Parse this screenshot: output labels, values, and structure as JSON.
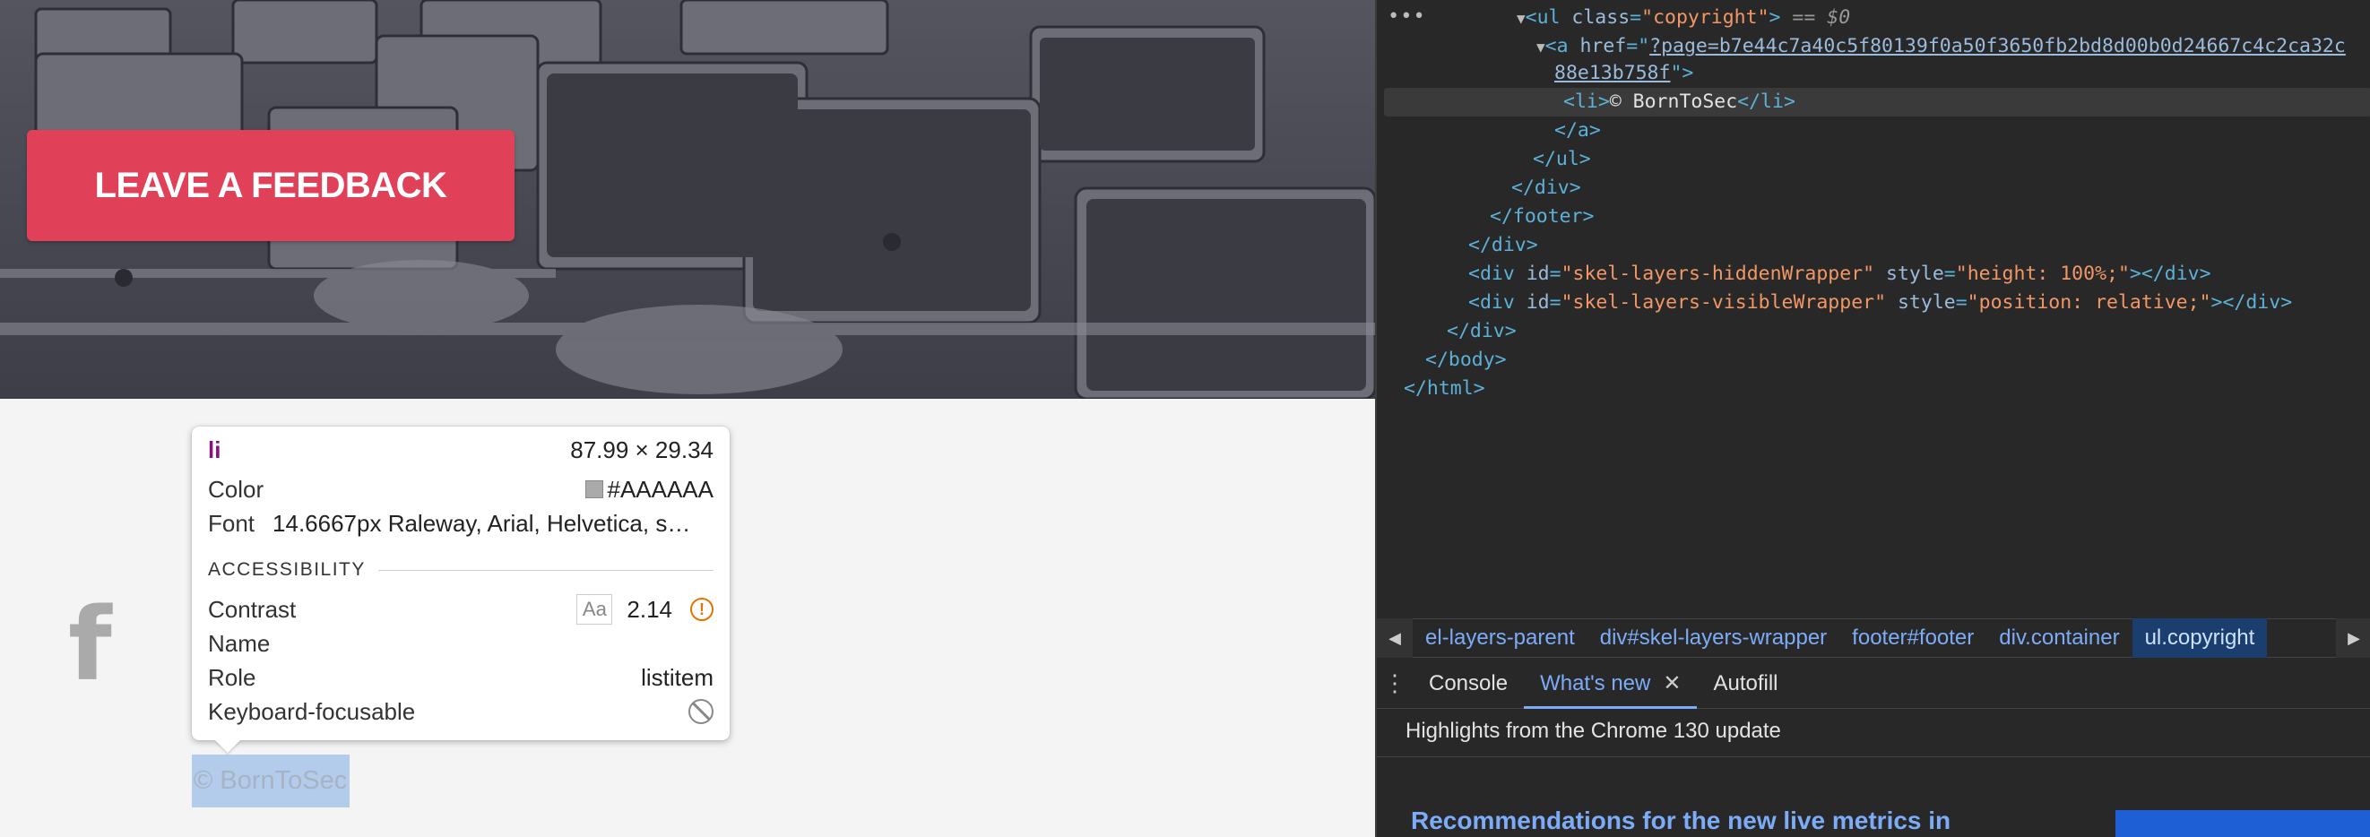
{
  "site": {
    "feedback_button": "LEAVE A FEEDBACK",
    "facebook_glyph": "f",
    "copyright": "© BornToSec"
  },
  "tooltip": {
    "tag": "li",
    "dimensions": "87.99 × 29.34",
    "color_label": "Color",
    "color_value": "#AAAAAA",
    "font_label": "Font",
    "font_value": "14.6667px Raleway, Arial, Helvetica, s…",
    "section_title": "ACCESSIBILITY",
    "contrast_label": "Contrast",
    "contrast_aa": "Aa",
    "contrast_value": "2.14",
    "name_label": "Name",
    "role_label": "Role",
    "role_value": "listitem",
    "keyboard_label": "Keyboard-focusable",
    "icons": [
      "warning-icon",
      "not-focusable-icon"
    ]
  },
  "devtools": {
    "dom": {
      "ul_open_class": "copyright",
      "selected_marker": "== $0",
      "a_href_part1": "?page=b7e44c7a40c5f80139f0a50f3650fb2bd8d00b0d24667c4c2ca32c",
      "a_href_part2": "88e13b758f",
      "li_text": "© BornToSec",
      "hidden_wrapper_id": "skel-layers-hiddenWrapper",
      "hidden_wrapper_style": "height: 100%;",
      "visible_wrapper_id": "skel-layers-visibleWrapper",
      "visible_wrapper_style": "position: relative;"
    },
    "breadcrumbs": [
      {
        "text": "el-layers-parent"
      },
      {
        "tag": "div",
        "rest": "#skel-layers-wrapper"
      },
      {
        "tag": "footer",
        "rest": "#footer"
      },
      {
        "tag": "div",
        "rest": ".container"
      },
      {
        "tag": "ul",
        "rest": ".copyright"
      }
    ],
    "drawer_tabs": [
      "Console",
      "What's new",
      "Autofill"
    ],
    "active_tab": "What's new",
    "whats_new_title": "Highlights from the Chrome 130 update",
    "whats_new_headline": "Recommendations for the new live metrics in"
  },
  "colors": {
    "feedback_button": "#e04159",
    "selection_highlight": "#b4cceb",
    "devtools_bg": "#282828",
    "accent_blue": "#7cacf8"
  }
}
